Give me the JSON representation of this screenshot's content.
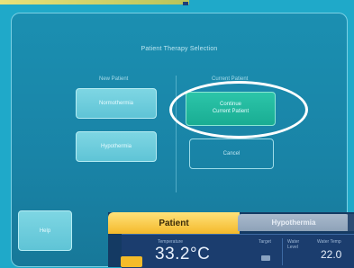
{
  "selection_screen": {
    "title": "Patient Therapy Selection",
    "new_patient_label": "New Patient",
    "current_patient_label": "Current Patient",
    "buttons": {
      "normothermia": "Normothermia",
      "hypothermia": "Hypothermia",
      "continue_line1": "Continue",
      "continue_line2": "Current Patient",
      "cancel": "Cancel"
    },
    "help_label": "Help"
  },
  "patient_screen": {
    "patient_tab": "Patient",
    "hypothermia_tab": "Hypothermia",
    "temperature_label": "Temperature",
    "temperature_value": "33.2°C",
    "target_label": "Target",
    "water_label_line1": "Water",
    "water_label_line2": "Level",
    "water_temp_label": "Water Temp",
    "water_value": "22.0"
  },
  "colors": {
    "background": "#1fa9c9",
    "continue_button": "#19ad93",
    "patient_tab": "#f4b92b"
  }
}
